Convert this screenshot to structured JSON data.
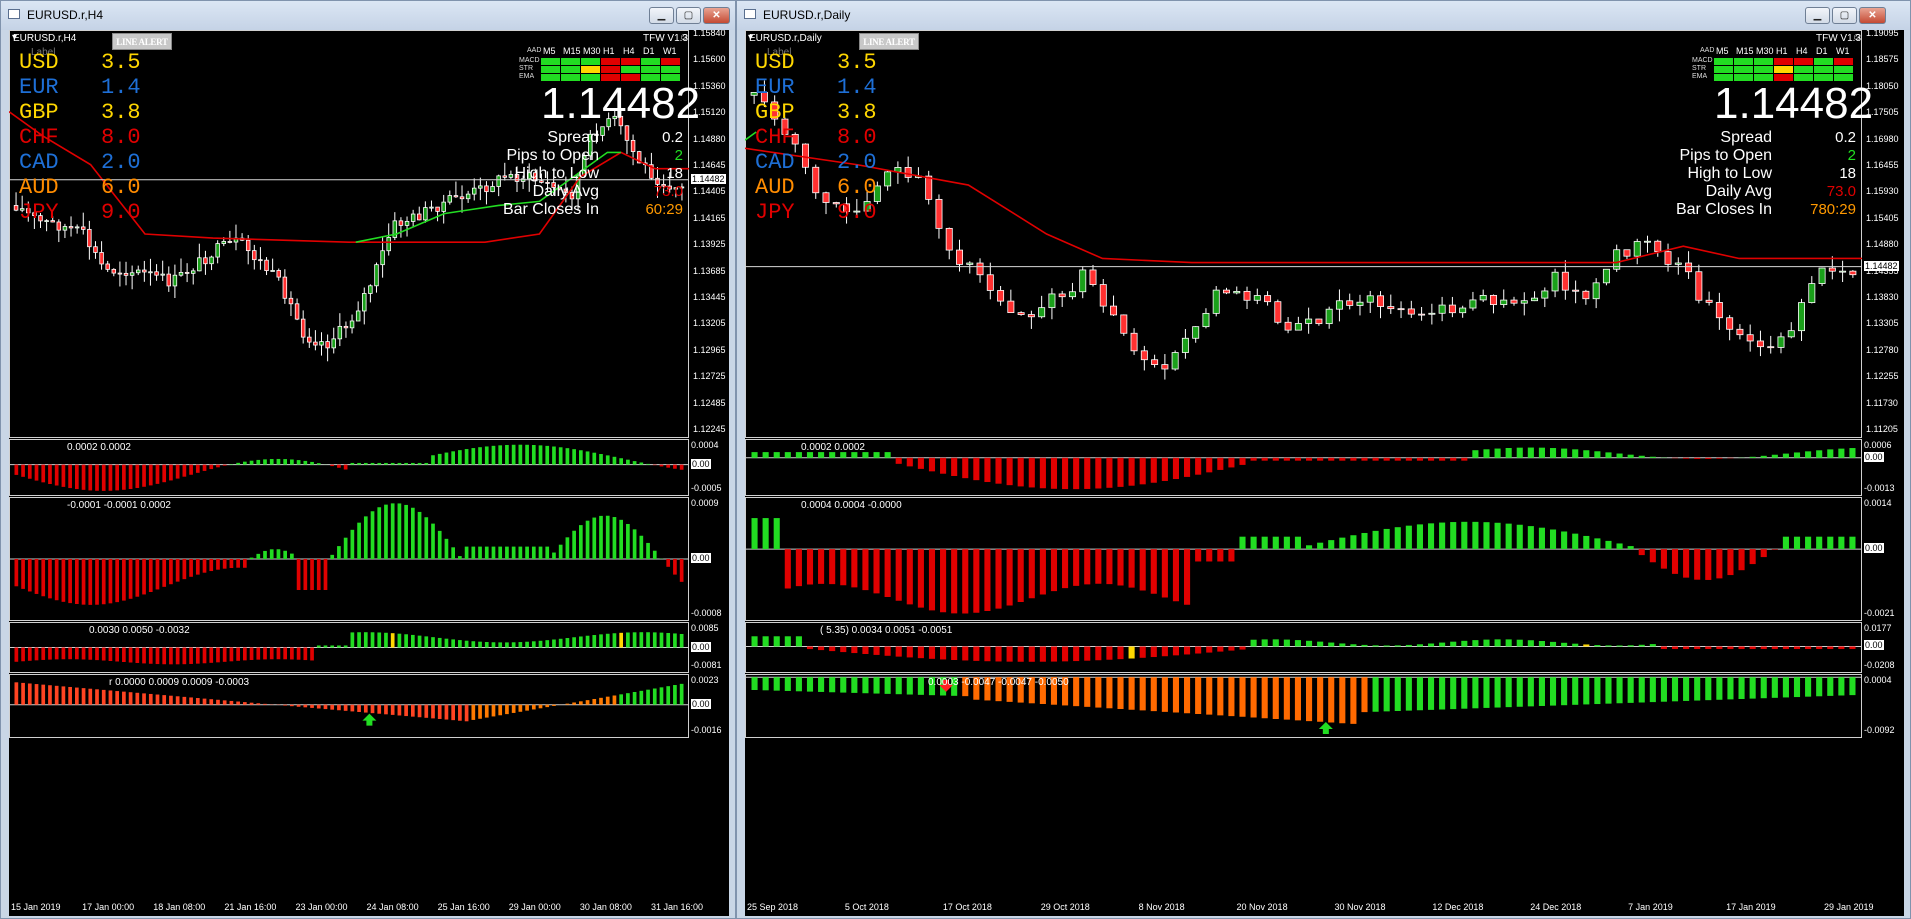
{
  "left": {
    "title": "EURUSD.r,H4",
    "symbol_tf": "EURUSD.r,H4",
    "alert_label": "LINE ALERT",
    "tfw": "TFW V1.3",
    "label_text": "Label",
    "currencies": [
      {
        "code": "USD",
        "value": "3.5",
        "color": "#ffd700"
      },
      {
        "code": "EUR",
        "value": "1.4",
        "color": "#1e6fd6"
      },
      {
        "code": "GBP",
        "value": "3.8",
        "color": "#ffd700"
      },
      {
        "code": "CHF",
        "value": "8.0",
        "color": "#e00000"
      },
      {
        "code": "CAD",
        "value": "2.0",
        "color": "#1e6fd6"
      },
      {
        "code": "AUD",
        "value": "6.0",
        "color": "#ff8c00"
      },
      {
        "code": "JPY",
        "value": "9.0",
        "color": "#e00000"
      }
    ],
    "mtf_headers": [
      "M5",
      "M15",
      "M30",
      "H1",
      "H4",
      "D1",
      "W1"
    ],
    "mtf_rows": [
      {
        "label": "MACD",
        "colors": [
          "#22dd22",
          "#22dd22",
          "#22dd22",
          "#e00000",
          "#e00000",
          "#22dd22",
          "#e00000"
        ]
      },
      {
        "label": "STR",
        "colors": [
          "#22dd22",
          "#22dd22",
          "#ffd700",
          "#e00000",
          "#22dd22",
          "#22dd22",
          "#22dd22"
        ]
      },
      {
        "label": "EMA",
        "colors": [
          "#22dd22",
          "#22dd22",
          "#22dd22",
          "#e00000",
          "#e00000",
          "#22dd22",
          "#22dd22"
        ]
      }
    ],
    "mtf_prefix": "AAD",
    "price": "1.14482",
    "stats": [
      {
        "label": "Spread",
        "value": "0.2",
        "color": "#ffffff"
      },
      {
        "label": "Pips to Open",
        "value": "2",
        "color": "#22dd22"
      },
      {
        "label": "High to Low",
        "value": "18",
        "color": "#ffffff"
      },
      {
        "label": "Daily Avg",
        "value": "73.0",
        "color": "#e00000"
      },
      {
        "label": "Bar Closes In",
        "value": "60:29",
        "color": "#ff9900"
      }
    ],
    "price_axis": [
      "1.15840",
      "1.15600",
      "1.15360",
      "1.15120",
      "1.14880",
      "1.14645",
      "1.14405",
      "1.14165",
      "1.13925",
      "1.13685",
      "1.13445",
      "1.13205",
      "1.12965",
      "1.12725",
      "1.12485",
      "1.12245"
    ],
    "current_price_tag": "1.14482",
    "ind1_text": "0.0002 0.0002",
    "ind1_axis": [
      "0.0004",
      "0.00",
      "-0.0005"
    ],
    "ind2_text": "-0.0001 -0.0001 0.0002",
    "ind2_axis": [
      "0.0009",
      "0.00",
      "-0.0008"
    ],
    "ind3_text": "0.0030 0.0050 -0.0032",
    "ind3_axis": [
      "0.0085",
      "0.00",
      "-0.0081"
    ],
    "ind4_text": "r 0.0000 0.0009 0.0009 -0.0003",
    "ind4_axis": [
      "0.0023",
      "0.00",
      "-0.0016"
    ],
    "time_axis": [
      "15 Jan 2019",
      "17 Jan 00:00",
      "18 Jan 08:00",
      "21 Jan 16:00",
      "23 Jan 00:00",
      "24 Jan 08:00",
      "25 Jan 16:00",
      "29 Jan 00:00",
      "30 Jan 08:00",
      "31 Jan 16:00"
    ]
  },
  "right": {
    "title": "EURUSD.r,Daily",
    "symbol_tf": "EURUSD.r,Daily",
    "alert_label": "LINE ALERT",
    "tfw": "TFW V1.3",
    "label_text": "Label",
    "currencies": [
      {
        "code": "USD",
        "value": "3.5",
        "color": "#ffd700"
      },
      {
        "code": "EUR",
        "value": "1.4",
        "color": "#1e6fd6"
      },
      {
        "code": "GBP",
        "value": "3.8",
        "color": "#ffd700"
      },
      {
        "code": "CHF",
        "value": "8.0",
        "color": "#e00000"
      },
      {
        "code": "CAD",
        "value": "2.0",
        "color": "#1e6fd6"
      },
      {
        "code": "AUD",
        "value": "6.0",
        "color": "#ff8c00"
      },
      {
        "code": "JPY",
        "value": "9.0",
        "color": "#e00000"
      }
    ],
    "mtf_headers": [
      "M5",
      "M15",
      "M30",
      "H1",
      "H4",
      "D1",
      "W1"
    ],
    "mtf_rows": [
      {
        "label": "MACD",
        "colors": [
          "#22dd22",
          "#22dd22",
          "#22dd22",
          "#e00000",
          "#e00000",
          "#22dd22",
          "#e00000"
        ]
      },
      {
        "label": "STR",
        "colors": [
          "#22dd22",
          "#22dd22",
          "#22dd22",
          "#ffd700",
          "#22dd22",
          "#22dd22",
          "#22dd22"
        ]
      },
      {
        "label": "EMA",
        "colors": [
          "#22dd22",
          "#22dd22",
          "#22dd22",
          "#e00000",
          "#22dd22",
          "#22dd22",
          "#22dd22"
        ]
      }
    ],
    "mtf_prefix": "AAD",
    "price": "1.14482",
    "stats": [
      {
        "label": "Spread",
        "value": "0.2",
        "color": "#ffffff"
      },
      {
        "label": "Pips to Open",
        "value": "2",
        "color": "#22dd22"
      },
      {
        "label": "High to Low",
        "value": "18",
        "color": "#ffffff"
      },
      {
        "label": "Daily Avg",
        "value": "73.0",
        "color": "#e00000"
      },
      {
        "label": "Bar Closes In",
        "value": "780:29",
        "color": "#ff9900"
      }
    ],
    "price_axis": [
      "1.19095",
      "1.18575",
      "1.18050",
      "1.17505",
      "1.16980",
      "1.16455",
      "1.15930",
      "1.15405",
      "1.14880",
      "1.14355",
      "1.13830",
      "1.13305",
      "1.12780",
      "1.12255",
      "1.11730",
      "1.11205"
    ],
    "current_price_tag": "1.14482",
    "ind1_text": "0.0002 0.0002",
    "ind1_axis": [
      "0.0006",
      "0.00",
      "-0.0013"
    ],
    "ind2_text": "0.0004 0.0004 -0.0000",
    "ind2_axis": [
      "0.0014",
      "0.00",
      "-0.0021"
    ],
    "ind3_text": "( 5.35) 0.0034 0.0051 -0.0051",
    "ind3_axis": [
      "0.0177",
      "0.00",
      "-0.0208"
    ],
    "ind4_text": "0.0003 -0.0047 -0.0047 -0.0050",
    "ind4_axis": [
      "0.0004",
      "-0.0092"
    ],
    "time_axis": [
      "25 Sep 2018",
      "5 Oct 2018",
      "17 Oct 2018",
      "29 Oct 2018",
      "8 Nov 2018",
      "20 Nov 2018",
      "30 Nov 2018",
      "12 Dec 2018",
      "24 Dec 2018",
      "7 Jan 2019",
      "17 Jan 2019",
      "29 Jan 2019"
    ]
  }
}
